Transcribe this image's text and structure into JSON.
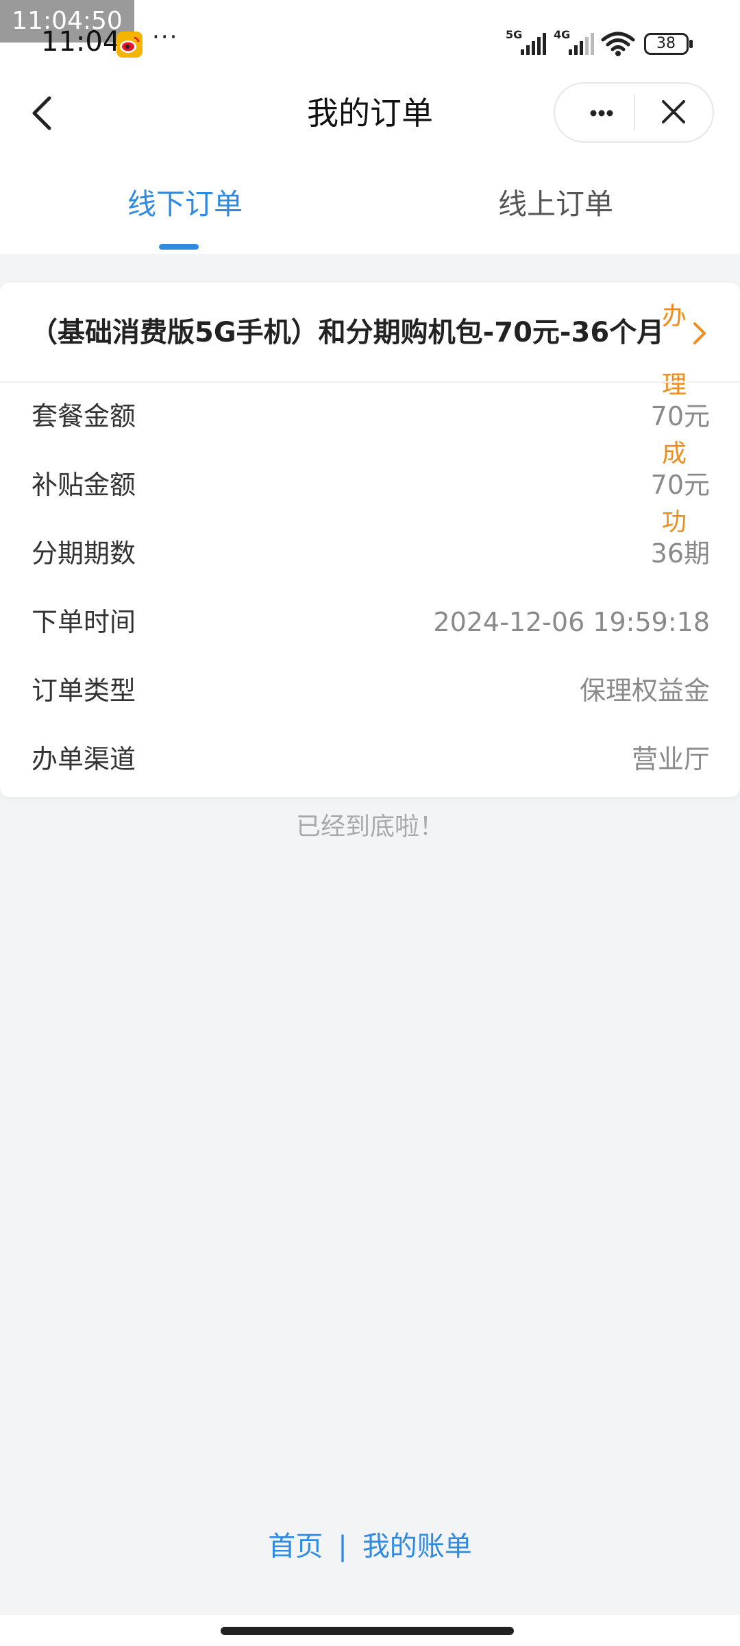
{
  "status_bar": {
    "time_chip": "11:04:50",
    "time": "11:04",
    "dots": "···",
    "battery": "38",
    "network_5g": "5G",
    "network_4g": "4G"
  },
  "header": {
    "title": "我的订单"
  },
  "tabs": [
    {
      "label": "线下订单",
      "active": true
    },
    {
      "label": "线上订单",
      "active": false
    }
  ],
  "order": {
    "title": "（基础消费版5G手机）和分期购机包-70元-36个月",
    "status_chars": [
      "办",
      "理",
      "成",
      "功"
    ],
    "rows": [
      {
        "label": "套餐金额",
        "value": "70元"
      },
      {
        "label": "补贴金额",
        "value": "70元"
      },
      {
        "label": "分期期数",
        "value": "36期"
      },
      {
        "label": "下单时间",
        "value": "2024-12-06 19:59:18"
      },
      {
        "label": "订单类型",
        "value": "保理权益金"
      },
      {
        "label": "办单渠道",
        "value": "营业厅"
      }
    ]
  },
  "end_text": "已经到底啦！",
  "footer": {
    "home": "首页",
    "separator": "|",
    "bill": "我的账单"
  },
  "colors": {
    "accent": "#2f8ae2",
    "status_orange": "#f08c1b",
    "background": "#f3f4f6"
  }
}
